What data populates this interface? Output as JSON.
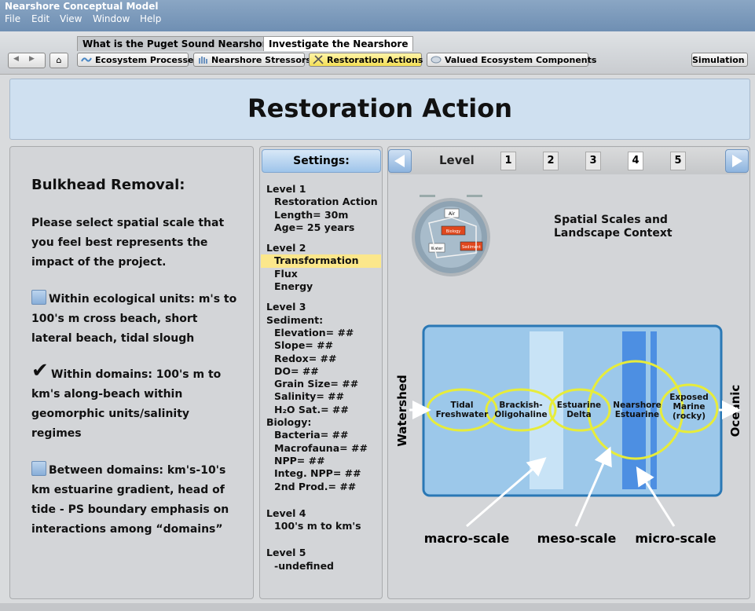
{
  "window": {
    "title": "Nearshore Conceptual Model",
    "menu": [
      "File",
      "Edit",
      "View",
      "Window",
      "Help"
    ]
  },
  "top_tabs": [
    "What is the Puget Sound Nearshore?",
    "Investigate the Nearshore"
  ],
  "nav": {
    "buttons": [
      "Ecosystem Processes",
      "Nearshore Stressors",
      "Restoration Actions",
      "Valued Ecosystem Components"
    ],
    "simulation_label": "Simulation"
  },
  "header": {
    "title": "Restoration Action"
  },
  "left_panel": {
    "heading": "Bulkhead Removal:",
    "prompt": "Please select spatial scale that you feel best represents the impact of the project.",
    "options": [
      {
        "lines": [
          "Within ecological units: m's to",
          "100's m cross beach, short",
          "lateral beach, tidal slough"
        ],
        "checked": false
      },
      {
        "lines": [
          "Within domains:  100's m to",
          "km's along-beach within",
          "geomorphic units/salinity",
          "regimes"
        ],
        "checked": true
      },
      {
        "lines": [
          "Between domains:  km's-10's",
          "km estuarine gradient, head of",
          "tide - PS boundary emphasis on",
          "interactions among “domains”"
        ],
        "checked": false
      }
    ]
  },
  "settings": {
    "title": "Settings:",
    "level1": {
      "label": "Level 1",
      "items": [
        "Restoration Action",
        "Length= 30m",
        "Age= 25 years"
      ]
    },
    "level2": {
      "label": "Level 2",
      "items": [
        "Transformation",
        "Flux",
        "Energy"
      ],
      "selected": "Transformation"
    },
    "level3": {
      "label": "Level 3",
      "sediment_label": "Sediment:",
      "sediment": [
        "Elevation= ##",
        "Slope= ##",
        "Redox= ##",
        "DO= ##",
        "Grain Size= ##",
        "Salinity= ##",
        "H₂O Sat.= ##"
      ],
      "biology_label": "Biology:",
      "biology": [
        "Bacteria= ##",
        "Macrofauna= ##",
        "NPP= ##",
        "Integ. NPP= ##",
        "2nd Prod.= ##"
      ]
    },
    "level4": {
      "label": "Level 4",
      "items": [
        "100's m to km's"
      ]
    },
    "level5": {
      "label": "Level 5",
      "items": [
        "-undefined"
      ]
    }
  },
  "level_nav": {
    "label": "Level",
    "levels": [
      "1",
      "2",
      "3",
      "4",
      "5"
    ],
    "active": "4"
  },
  "diagram": {
    "title_line1": "Spatial Scales and",
    "title_line2": "Landscape Context",
    "thumb_labels": [
      "Air",
      "Biology",
      "Water",
      "Sediment"
    ],
    "left_label": "Watershed",
    "right_label": "Oceanic",
    "zones": [
      "Tidal",
      "Freshwater",
      "Brackish-",
      "Oligohaline",
      "Estuarine",
      "Delta",
      "Nearshore",
      "Estuarine",
      "Exposed",
      "Marine",
      "(rocky)"
    ],
    "scales": [
      "macro-scale",
      "meso-scale",
      "micro-scale"
    ],
    "colors": {
      "water": "#9cc8ea",
      "frame": "#2a78b5",
      "ellipse": "#e7ec3a",
      "band_light": "#c8e3f6",
      "band_dark": "#4d8fe2"
    }
  }
}
